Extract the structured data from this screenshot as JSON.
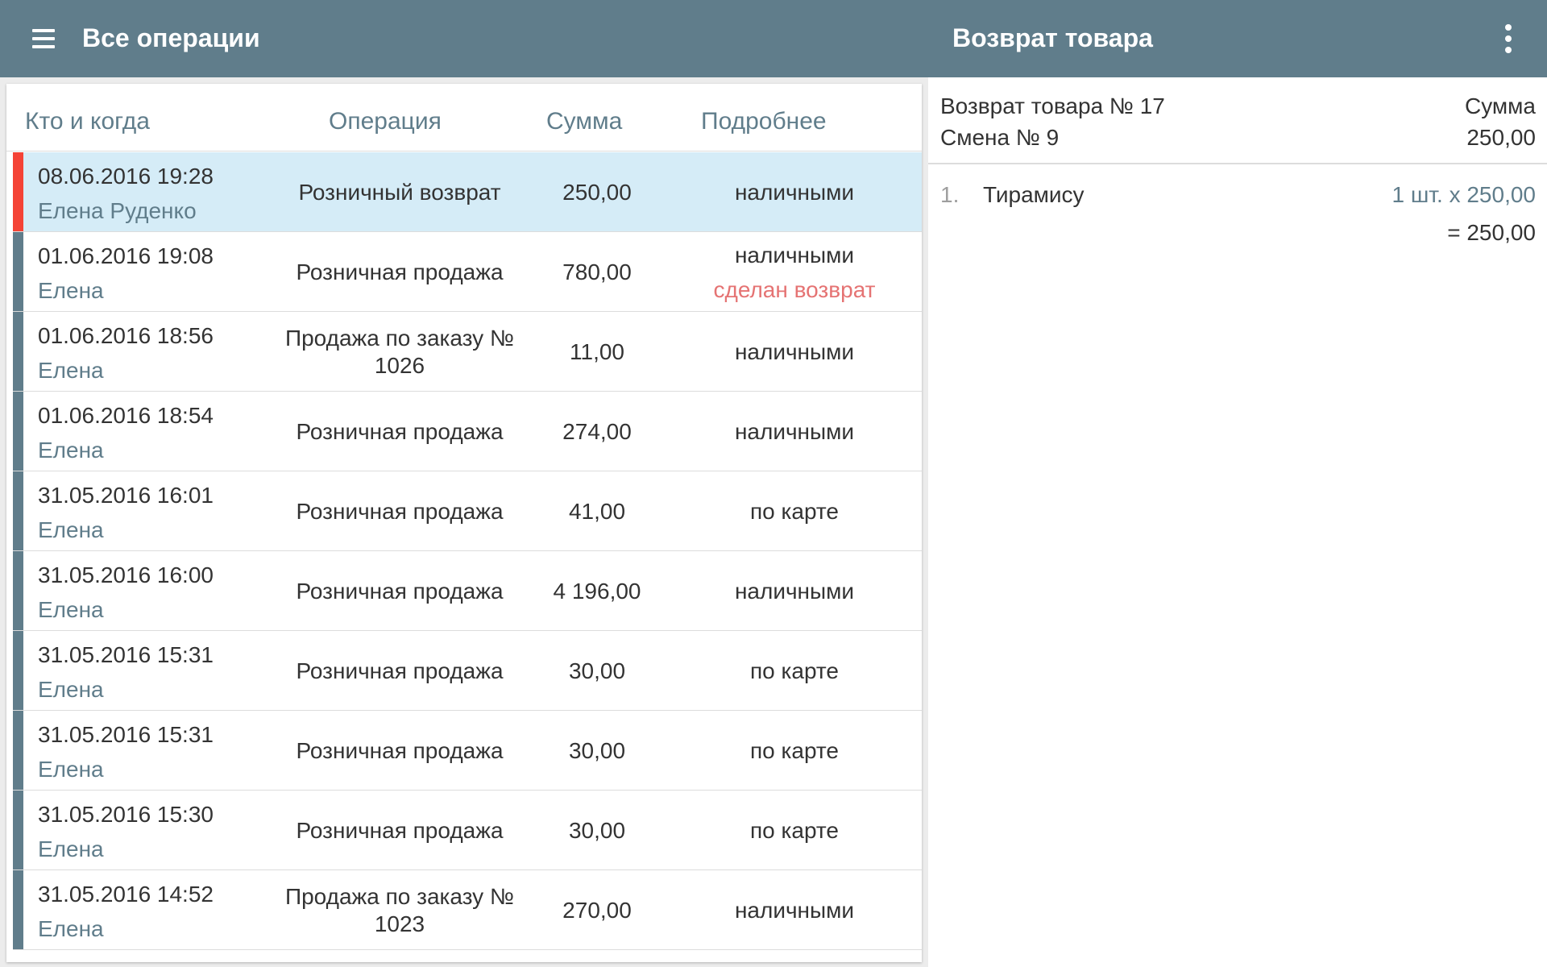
{
  "appbar": {
    "left_title": "Все операции",
    "right_title": "Возврат товара",
    "menu_icon": "hamburger-menu-icon",
    "more_icon": "more-vert-icon",
    "color": "#607d8b"
  },
  "table": {
    "headers": {
      "who": "Кто и когда",
      "operation": "Операция",
      "sum": "Сумма",
      "details": "Подробнее"
    },
    "rows": [
      {
        "date": "08.06.2016 19:28",
        "user": "Елена Руденко",
        "operation": "Розничный возврат",
        "sum": "250,00",
        "payment": "наличными",
        "note": "",
        "selected": true,
        "stripe": "#f44336"
      },
      {
        "date": "01.06.2016 19:08",
        "user": "Елена",
        "operation": "Розничная продажа",
        "sum": "780,00",
        "payment": "наличными",
        "note": "сделан возврат",
        "selected": false,
        "stripe": "#607d8b"
      },
      {
        "date": "01.06.2016 18:56",
        "user": "Елена",
        "operation": "Продажа по заказу № 1026",
        "sum": "11,00",
        "payment": "наличными",
        "note": "",
        "selected": false,
        "stripe": "#607d8b"
      },
      {
        "date": "01.06.2016 18:54",
        "user": "Елена",
        "operation": "Розничная продажа",
        "sum": "274,00",
        "payment": "наличными",
        "note": "",
        "selected": false,
        "stripe": "#607d8b"
      },
      {
        "date": "31.05.2016 16:01",
        "user": "Елена",
        "operation": "Розничная продажа",
        "sum": "41,00",
        "payment": "по карте",
        "note": "",
        "selected": false,
        "stripe": "#607d8b"
      },
      {
        "date": "31.05.2016 16:00",
        "user": "Елена",
        "operation": "Розничная продажа",
        "sum": "4 196,00",
        "payment": "наличными",
        "note": "",
        "selected": false,
        "stripe": "#607d8b"
      },
      {
        "date": "31.05.2016 15:31",
        "user": "Елена",
        "operation": "Розничная продажа",
        "sum": "30,00",
        "payment": "по карте",
        "note": "",
        "selected": false,
        "stripe": "#607d8b"
      },
      {
        "date": "31.05.2016 15:31",
        "user": "Елена",
        "operation": "Розничная продажа",
        "sum": "30,00",
        "payment": "по карте",
        "note": "",
        "selected": false,
        "stripe": "#607d8b"
      },
      {
        "date": "31.05.2016 15:30",
        "user": "Елена",
        "operation": "Розничная продажа",
        "sum": "30,00",
        "payment": "по карте",
        "note": "",
        "selected": false,
        "stripe": "#607d8b"
      },
      {
        "date": "31.05.2016 14:52",
        "user": "Елена",
        "operation": "Продажа по заказу № 1023",
        "sum": "270,00",
        "payment": "наличными",
        "note": "",
        "selected": false,
        "stripe": "#607d8b"
      }
    ]
  },
  "detail": {
    "doc_number": "Возврат товара № 17",
    "shift": "Смена № 9",
    "sum_label": "Сумма",
    "sum_value": "250,00",
    "items": [
      {
        "index": "1.",
        "name": "Тирамису",
        "qty_price": "1 шт. x 250,00",
        "total": "= 250,00"
      }
    ]
  }
}
